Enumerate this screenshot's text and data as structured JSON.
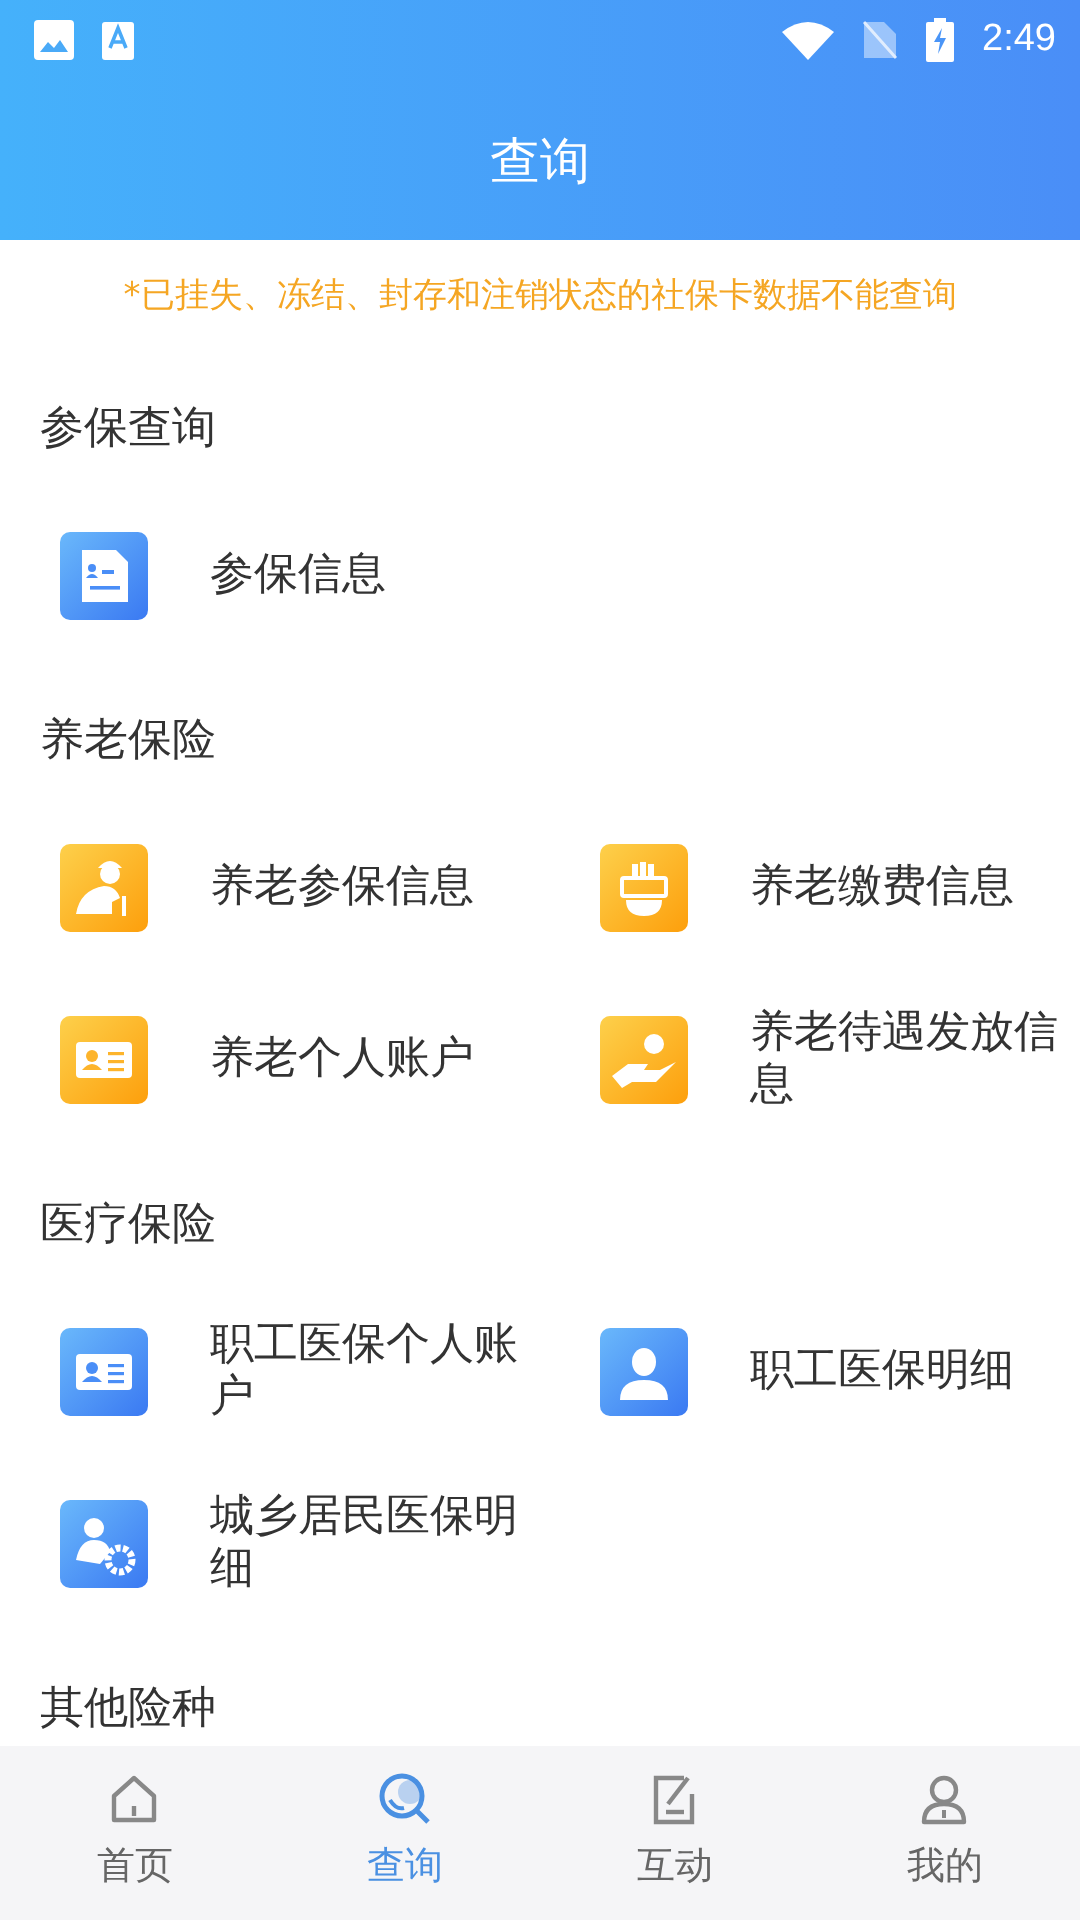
{
  "status_bar": {
    "time": "2:49"
  },
  "header": {
    "title": "查询"
  },
  "notice": "*已挂失、冻结、封存和注销状态的社保卡数据不能查询",
  "sections": [
    {
      "title": "参保查询",
      "items": [
        {
          "label": "参保信息",
          "kind": "document"
        }
      ]
    },
    {
      "title": "养老保险",
      "items": [
        {
          "label": "养老参保信息",
          "kind": "elder"
        },
        {
          "label": "养老缴费信息",
          "kind": "payment"
        },
        {
          "label": "养老个人账户",
          "kind": "card-orange"
        },
        {
          "label": "养老待遇发放信息",
          "kind": "benefit"
        }
      ]
    },
    {
      "title": "医疗保险",
      "items": [
        {
          "label": "职工医保个人账户",
          "kind": "card-blue"
        },
        {
          "label": "职工医保明细",
          "kind": "doctor"
        },
        {
          "label": "城乡居民医保明细",
          "kind": "group"
        }
      ]
    },
    {
      "title": "其他险种"
    }
  ],
  "tabs": [
    {
      "label": "首页",
      "kind": "home",
      "selected": false
    },
    {
      "label": "查询",
      "kind": "search",
      "selected": true
    },
    {
      "label": "互动",
      "kind": "edit",
      "selected": false
    },
    {
      "label": "我的",
      "kind": "user",
      "selected": false
    }
  ]
}
